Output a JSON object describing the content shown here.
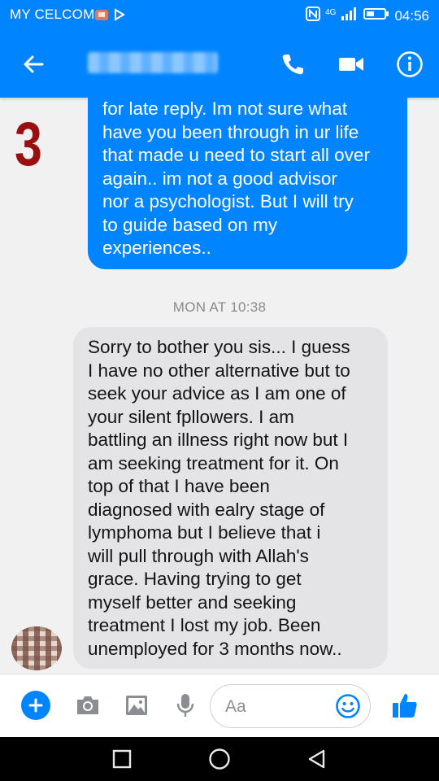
{
  "status_bar": {
    "carrier": "MY CELCOM",
    "network": "4G",
    "time": "04:56",
    "icons": [
      "notification-icon",
      "nfc-icon",
      "signal-icon",
      "battery-icon"
    ]
  },
  "header": {
    "contact_name": "",
    "icons": [
      "back-arrow-icon",
      "phone-icon",
      "video-camera-icon",
      "info-icon"
    ]
  },
  "annotation": "3",
  "messages": [
    {
      "direction": "outgoing",
      "lines": [
        "for late reply.  Im not sure what",
        "have you been through in ur life",
        "that made u need to start all over",
        "again..  im not a good advisor",
        "nor a psychologist.  But I will try",
        "to guide based on my",
        "experiences.."
      ]
    },
    {
      "type": "timestamp",
      "text": "MON AT 10:38"
    },
    {
      "direction": "incoming",
      "lines": [
        "Sorry to bother you sis... I guess",
        "I have no other alternative but to",
        "seek your advice as I am one of",
        "your silent fpllowers. I am",
        "battling an illness right now but I",
        "am seeking treatment for it. On",
        "top of that I have been",
        "diagnosed with ealry stage of",
        "lymphoma but I believe that  i",
        "will pull through with Allah's",
        "grace. Having trying to get",
        "myself better and seeking",
        "treatment I lost my job. Been",
        "unemployed for 3 months now.."
      ]
    }
  ],
  "composer": {
    "placeholder": "Aa",
    "icons": [
      "plus-icon",
      "camera-icon",
      "image-icon",
      "microphone-icon",
      "emoji-icon",
      "thumbs-up-icon"
    ]
  },
  "nav_bar": {
    "icons": [
      "recents-square-icon",
      "home-circle-icon",
      "back-triangle-icon"
    ]
  },
  "colors": {
    "messenger_blue": "#0084ff",
    "incoming_bubble": "#e4e4e6",
    "annotation_red": "#9a1010"
  }
}
